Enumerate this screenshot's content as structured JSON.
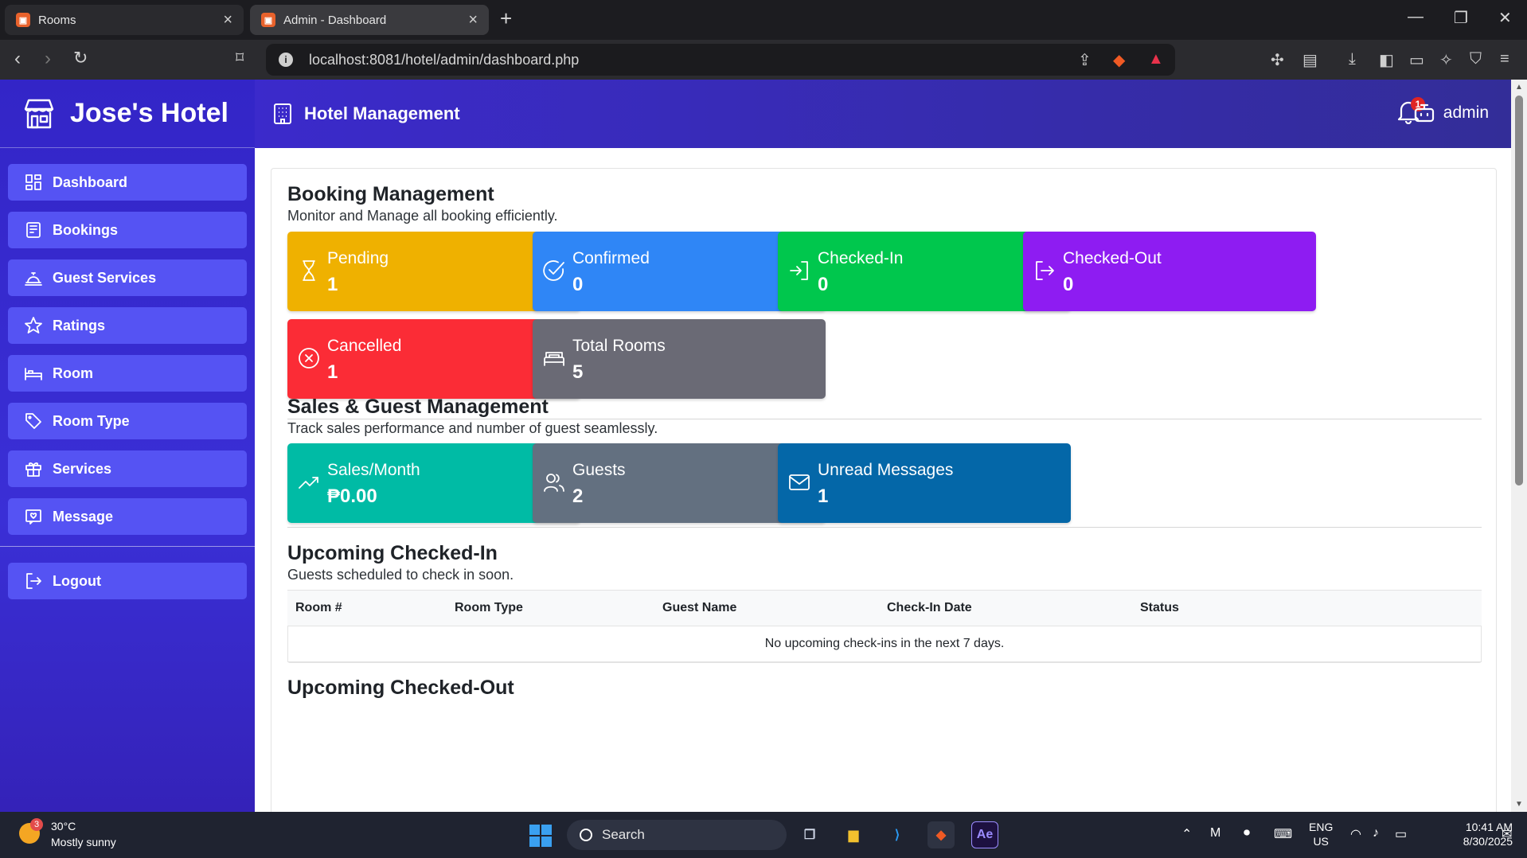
{
  "browser": {
    "tabs": [
      {
        "title": "Rooms",
        "active": false
      },
      {
        "title": "Admin - Dashboard",
        "active": true
      }
    ],
    "url": "localhost:8081/hotel/admin/dashboard.php"
  },
  "sidebar": {
    "brand": "Jose's Hotel",
    "items": [
      {
        "label": "Dashboard",
        "icon": "dashboard-icon"
      },
      {
        "label": "Bookings",
        "icon": "bookings-icon"
      },
      {
        "label": "Guest Services",
        "icon": "bell-service-icon"
      },
      {
        "label": "Ratings",
        "icon": "star-icon"
      },
      {
        "label": "Room",
        "icon": "bed-icon"
      },
      {
        "label": "Room Type",
        "icon": "tag-icon"
      },
      {
        "label": "Services",
        "icon": "gift-icon"
      },
      {
        "label": "Message",
        "icon": "message-icon"
      }
    ],
    "logout": "Logout"
  },
  "topbar": {
    "title": "Hotel Management",
    "notification_count": "1",
    "user": "admin"
  },
  "booking": {
    "title": "Booking Management",
    "subtitle": "Monitor and Manage all booking efficiently.",
    "stats": [
      {
        "label": "Pending",
        "value": "1",
        "color": "#efb100",
        "icon": "hourglass-icon"
      },
      {
        "label": "Confirmed",
        "value": "0",
        "color": "#2f86f6",
        "icon": "check-circle-icon"
      },
      {
        "label": "Checked-In",
        "value": "0",
        "color": "#00c74d",
        "icon": "sign-in-icon"
      },
      {
        "label": "Checked-Out",
        "value": "0",
        "color": "#8e1cf2",
        "icon": "sign-out-icon"
      },
      {
        "label": "Cancelled",
        "value": "1",
        "color": "#fb2c36",
        "icon": "x-circle-icon"
      },
      {
        "label": "Total Rooms",
        "value": "5",
        "color": "#6a6a75",
        "icon": "bed-icon"
      }
    ]
  },
  "sales": {
    "title": "Sales & Guest Management",
    "subtitle": "Track sales performance and number of guest seamlessly.",
    "stats": [
      {
        "label": "Sales/Month",
        "value": "₱0.00",
        "color": "#00bba5",
        "icon": "trending-up-icon"
      },
      {
        "label": "Guests",
        "value": "2",
        "color": "#637080",
        "icon": "users-icon"
      },
      {
        "label": "Unread Messages",
        "value": "1",
        "color": "#0467a8",
        "icon": "envelope-icon"
      }
    ]
  },
  "upcoming_checkin": {
    "title": "Upcoming Checked-In",
    "subtitle": "Guests scheduled to check in soon.",
    "columns": [
      "Room #",
      "Room Type",
      "Guest Name",
      "Check-In Date",
      "Status"
    ],
    "empty_message": "No upcoming check-ins in the next 7 days."
  },
  "upcoming_checkout": {
    "title": "Upcoming Checked-Out"
  },
  "taskbar": {
    "weather_badge": "3",
    "temperature": "30°C",
    "condition": "Mostly sunny",
    "search": "Search",
    "lang1": "ENG",
    "lang2": "US",
    "time": "10:41 AM",
    "date": "8/30/2025"
  }
}
